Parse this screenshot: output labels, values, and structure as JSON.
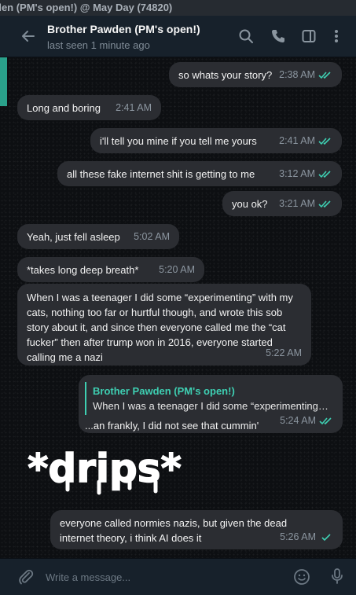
{
  "window": {
    "title": "den (PM's open!) @ May Day (74820)"
  },
  "header": {
    "contact_name": "Brother Pawden (PM's open!)",
    "status": "last seen 1 minute ago",
    "icons": [
      "back-arrow-icon",
      "search-icon",
      "phone-icon",
      "sidebar-toggle-icon",
      "more-vertical-icon"
    ]
  },
  "messages": [
    {
      "dir": "out",
      "text": "so whats your story?",
      "time": "2:38 AM",
      "read": true
    },
    {
      "dir": "in",
      "text": "Long and boring",
      "time": "2:41 AM"
    },
    {
      "dir": "out",
      "text": "i'll tell you mine if you tell me yours",
      "time": "2:41 AM",
      "read": true
    },
    {
      "dir": "out",
      "text": "all these fake internet shit is getting to me",
      "time": "3:12 AM",
      "read": true
    },
    {
      "dir": "out",
      "text": "you ok?",
      "time": "3:21 AM",
      "read": true
    },
    {
      "dir": "in",
      "text": "Yeah, just fell asleep",
      "time": "5:02 AM"
    },
    {
      "dir": "in",
      "text": "*takes long deep breath*",
      "time": "5:20 AM"
    },
    {
      "dir": "in",
      "text": "When I was a teenager I did some “experimenting” with my cats, nothing too far or hurtful though, and wrote this sob story about it, and since then everyone called me the “cat fucker” then after trump won in 2016, everyone started calling me a nazi",
      "time": "5:22 AM"
    },
    {
      "dir": "out",
      "reply_name": "Brother Pawden (PM's open!)",
      "reply_text": "When I was a teenager I did some “experimenting” with my cats",
      "text": "...an frankly, I did not see that cummin'",
      "time": "5:24 AM",
      "read": true
    },
    {
      "dir": "out",
      "text": "everyone called normies nazis, but given the dead internet theory, i think AI does it",
      "time": "5:26 AM",
      "read": true,
      "single_check": true
    }
  ],
  "sticker": {
    "text": "*drips*"
  },
  "composer": {
    "placeholder": "Write a message...",
    "icons": [
      "attach-icon",
      "emoji-icon",
      "microphone-icon"
    ]
  },
  "colors": {
    "accent": "#3ecfb2",
    "bubble": "#2b2d32",
    "header": "#17212b",
    "titlebar": "#262b31"
  }
}
